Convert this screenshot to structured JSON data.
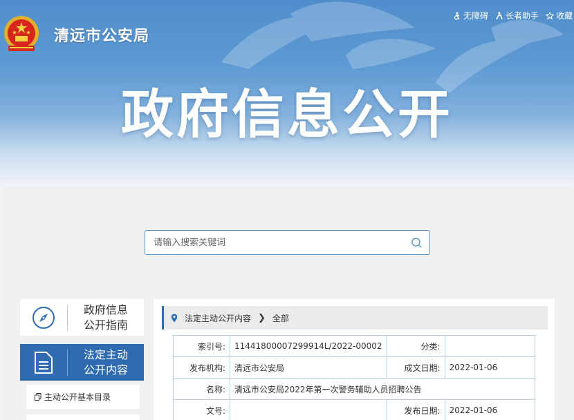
{
  "header": {
    "site_title": "清远市公安局",
    "links": [
      {
        "label": "无障碍",
        "icon": "accessibility-icon"
      },
      {
        "label": "长者助手",
        "icon": "elder-helper-icon"
      },
      {
        "label": "收藏",
        "icon": "star-icon"
      }
    ],
    "banner_title": "政府信息公开"
  },
  "search": {
    "placeholder": "请输入搜索关键词",
    "value": ""
  },
  "nav": {
    "guide_line1": "政府信息",
    "guide_line2": "公开指南",
    "active_line1": "法定主动",
    "active_line2": "公开内容",
    "sub_items": [
      "主动公开基本目录",
      ""
    ]
  },
  "breadcrumb": {
    "items": [
      "法定主动公开内容",
      "全部"
    ]
  },
  "info_table": {
    "index_label": "索引号:",
    "index_value": "11441800007299914L/2022-00002",
    "category_label": "分类:",
    "category_value": "",
    "publisher_label": "发布机构:",
    "publisher_value": "清远市公安局",
    "written_date_label": "成文日期:",
    "written_date_value": "2022-01-06",
    "name_label": "名称:",
    "name_value": "清远市公安局2022年第一次警务辅助人员招聘公告",
    "doc_no_label": "文号:",
    "doc_no_value": "",
    "publish_date_label": "发布日期:",
    "publish_date_value": "2022-01-06"
  },
  "colors": {
    "accent": "#2e6bb0",
    "banner_top": "#4f8dcc",
    "table_border": "#b8cde3"
  }
}
